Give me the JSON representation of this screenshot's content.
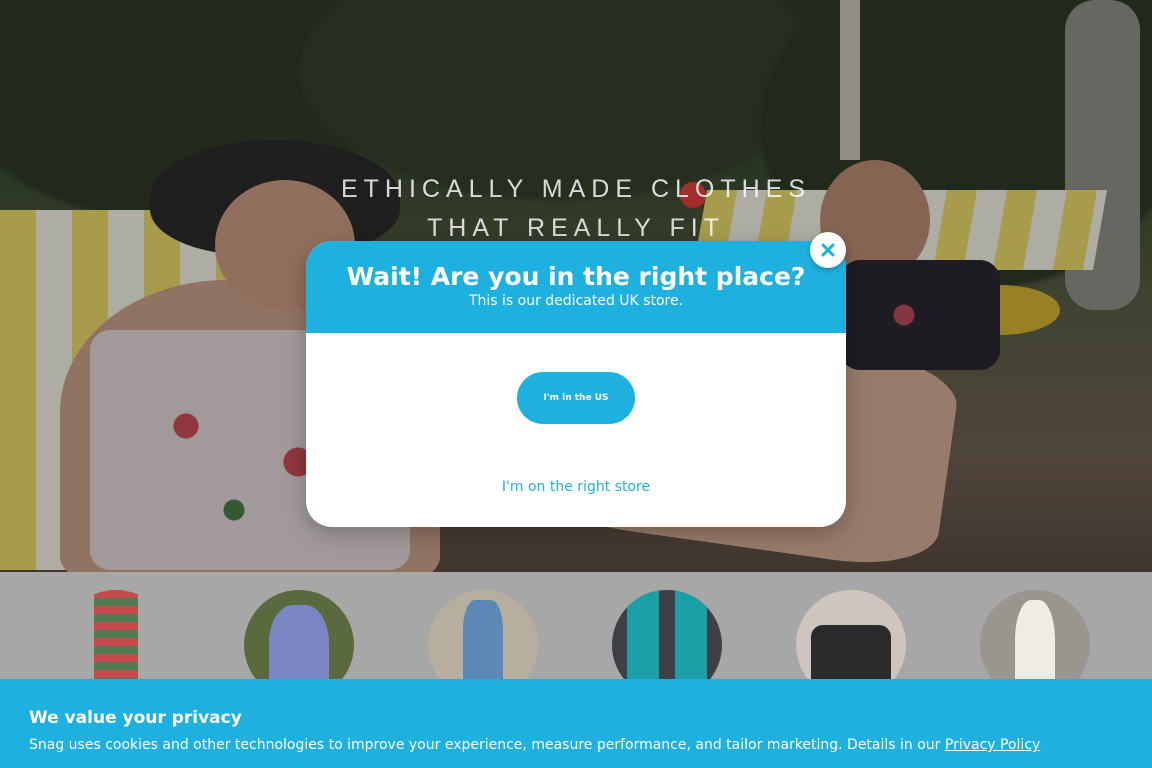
{
  "hero": {
    "headline_line1": "ETHICALLY MADE CLOTHES",
    "headline_line2": "THAT REALLY FIT"
  },
  "modal": {
    "title": "Wait! Are you in the right place?",
    "subtitle": "This is our dedicated UK store.",
    "us_button_label": "I'm in the US",
    "right_store_label": "I'm on the right store",
    "close_icon": "close-icon"
  },
  "category_strip": {
    "items": [
      {
        "icon": "category-image-striped-tights"
      },
      {
        "icon": "category-image-floral-dress"
      },
      {
        "icon": "category-image-denim-jacket"
      },
      {
        "icon": "category-image-teal-tights"
      },
      {
        "icon": "category-image-leather-skirt"
      },
      {
        "icon": "category-image-cream-knit"
      }
    ]
  },
  "privacy": {
    "title": "We value your privacy",
    "text": "Snag uses cookies and other technologies to improve your experience, measure performance, and tailor marketing. Details in our ",
    "link_label": "Privacy Policy"
  },
  "colors": {
    "accent": "#1eb0df",
    "strip_background": "#a7a7a7"
  }
}
